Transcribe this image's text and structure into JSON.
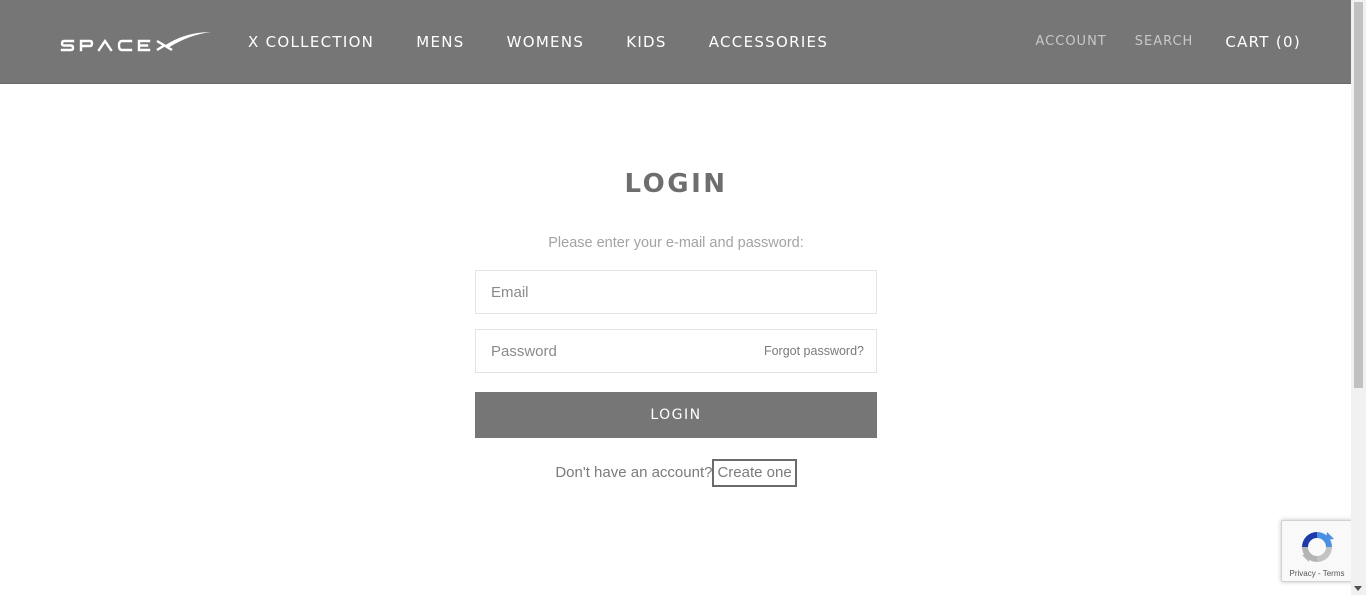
{
  "header": {
    "brand": "SPACEX",
    "nav": [
      {
        "label": "X COLLECTION"
      },
      {
        "label": "MENS"
      },
      {
        "label": "WOMENS"
      },
      {
        "label": "KIDS"
      },
      {
        "label": "ACCESSORIES"
      }
    ],
    "account_label": "ACCOUNT",
    "search_label": "SEARCH",
    "cart_label": "CART (0)"
  },
  "login": {
    "title": "LOGIN",
    "subtitle": "Please enter your e-mail and password:",
    "email_placeholder": "Email",
    "password_placeholder": "Password",
    "forgot_label": "Forgot password?",
    "submit_label": "LOGIN",
    "no_account_text": "Don't have an account?",
    "create_label": "Create one"
  },
  "recaptcha": {
    "privacy_label": "Privacy",
    "separator": " - ",
    "terms_label": "Terms"
  },
  "colors": {
    "header_bg": "#767676",
    "button_bg": "#767676",
    "title_text": "#6e6e6e",
    "subtitle_text": "#a3a3a3"
  }
}
